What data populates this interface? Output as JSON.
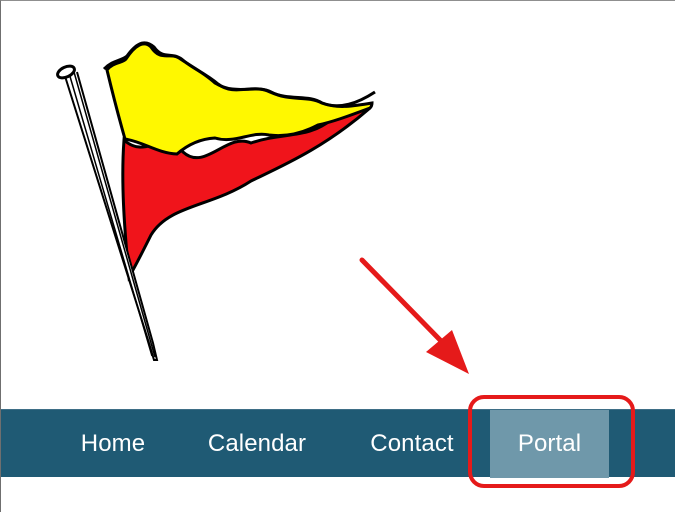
{
  "navigation": {
    "items": [
      {
        "label": "Home"
      },
      {
        "label": "Calendar"
      },
      {
        "label": "Contact"
      },
      {
        "label": "Portal",
        "active": true
      }
    ]
  },
  "colors": {
    "nav_background": "#1f5a74",
    "active_item_background": "#6f98aa",
    "annotation_red": "#e51a1a",
    "flag_yellow": "#fff800",
    "flag_red": "#f0141b"
  },
  "icons": {
    "logo": "burgee-flag-icon",
    "annotation_arrow": "red-arrow-icon"
  }
}
